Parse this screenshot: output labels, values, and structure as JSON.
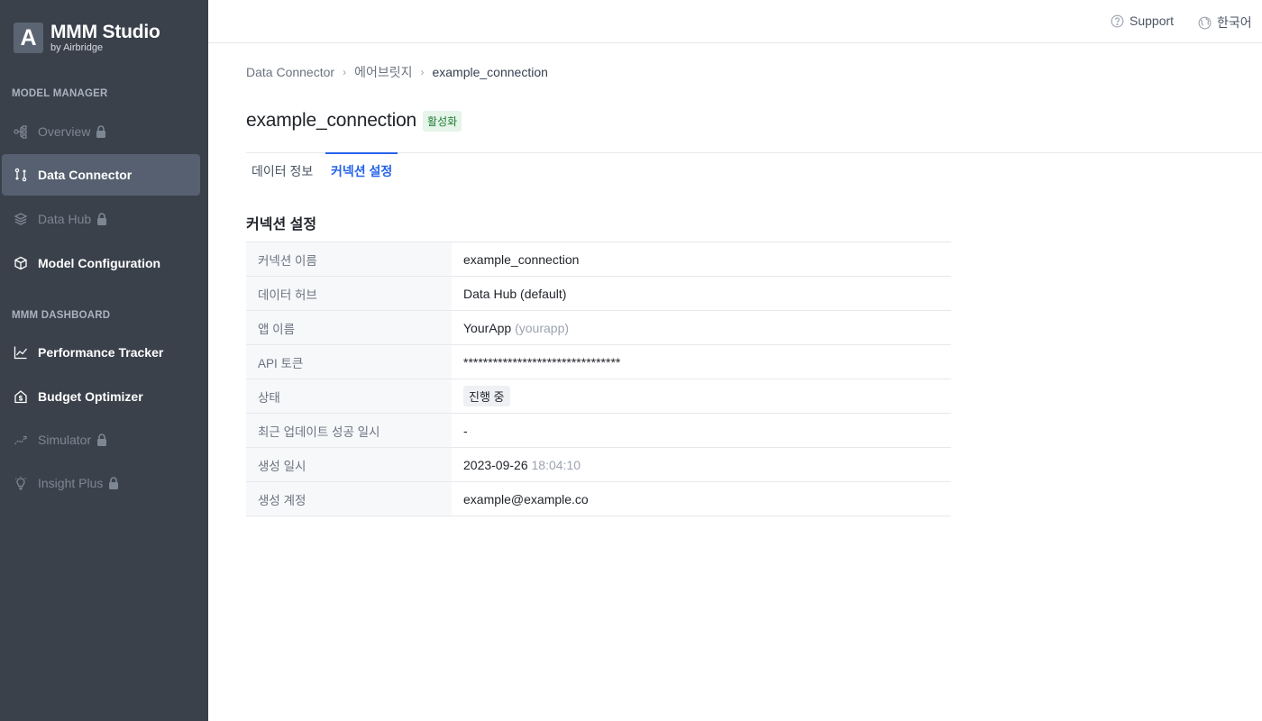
{
  "app": {
    "logo_letter": "A",
    "title": "MMM Studio",
    "subtitle": "by Airbridge"
  },
  "sidebar": {
    "sections": [
      {
        "title": "MODEL MANAGER",
        "items": [
          {
            "label": "Overview",
            "icon": "hierarchy-icon",
            "locked": true,
            "active": false
          },
          {
            "label": "Data Connector",
            "icon": "connector-icon",
            "locked": false,
            "active": true
          },
          {
            "label": "Data Hub",
            "icon": "layers-icon",
            "locked": true,
            "active": false
          },
          {
            "label": "Model Configuration",
            "icon": "cube-icon",
            "locked": false,
            "active": false
          }
        ]
      },
      {
        "title": "MMM DASHBOARD",
        "items": [
          {
            "label": "Performance Tracker",
            "icon": "line-chart-icon",
            "locked": false,
            "active": false
          },
          {
            "label": "Budget Optimizer",
            "icon": "house-dollar-icon",
            "locked": false,
            "active": false
          },
          {
            "label": "Simulator",
            "icon": "trend-icon",
            "locked": true,
            "active": false
          },
          {
            "label": "Insight Plus",
            "icon": "lightbulb-icon",
            "locked": true,
            "active": false
          }
        ]
      }
    ]
  },
  "topbar": {
    "support_label": "Support",
    "language_label": "한국어"
  },
  "breadcrumb": [
    "Data Connector",
    "에어브릿지",
    "example_connection"
  ],
  "page": {
    "title": "example_connection",
    "status": "활성화"
  },
  "tabs": [
    {
      "label": "데이터 정보",
      "active": false
    },
    {
      "label": "커넥션 설정",
      "active": true
    }
  ],
  "section": {
    "heading": "커넥션 설정",
    "rows": [
      {
        "key": "커넥션 이름",
        "value": "example_connection"
      },
      {
        "key": "데이터 허브",
        "value": "Data Hub (default)"
      },
      {
        "key": "앱 이름",
        "value": "YourApp",
        "value_muted": "(yourapp)"
      },
      {
        "key": "API 토큰",
        "value": "********************************"
      },
      {
        "key": "상태",
        "value": "진행 중"
      },
      {
        "key": "최근 업데이트 성공 일시",
        "value": "-"
      },
      {
        "key": "생성 일시",
        "value": "2023-09-26",
        "value_muted": "18:04:10"
      },
      {
        "key": "생성 계정",
        "value": "example@example.co"
      }
    ]
  },
  "colors": {
    "sidebar_bg": "#3a414b",
    "sidebar_active": "#566070",
    "accent": "#2563eb",
    "status_green": "#1e7e34"
  }
}
